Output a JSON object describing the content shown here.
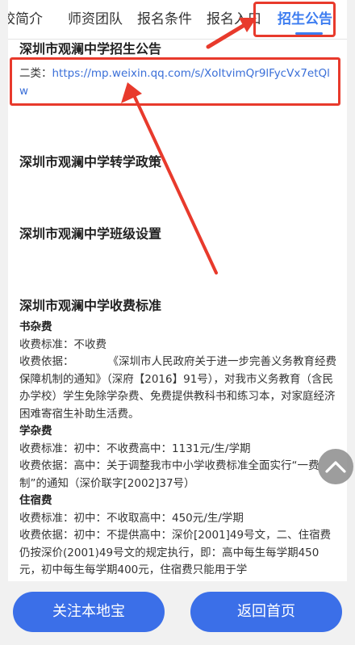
{
  "tabs": [
    {
      "label": "校简介"
    },
    {
      "label": "师资团队"
    },
    {
      "label": "报名条件"
    },
    {
      "label": "报名入口"
    },
    {
      "label": "招生公告"
    }
  ],
  "active_tab": "招生公告",
  "sections": {
    "admission_notice": {
      "title": "深圳市观澜中学招生公告",
      "link_prefix": "二类：",
      "link_url": "https://mp.weixin.qq.com/s/XoItvimQr9lFycVx7etQlw"
    },
    "transfer_policy": {
      "title": "深圳市观澜中学转学政策"
    },
    "class_settings": {
      "title": "深圳市观澜中学班级设置"
    },
    "fee_standard": {
      "title": "深圳市观澜中学收费标准",
      "book_fee": {
        "title": "书杂费",
        "standard": "收费标准：不收费",
        "basis_label": "收费依据：",
        "basis": "《深圳市人民政府关于进一步完善义务教育经费保障机制的通知》（深府【2016】91号），对我市义务教育（含民办学校）学生免除学杂费、免费提供教科书和练习本，对家庭经济困难寄宿生补助生活费。"
      },
      "tuition_fee": {
        "title": "学杂费",
        "standard": "收费标准：初中：不收费高中：1131元/生/学期",
        "basis": "收费依据：高中：关于调整我市中小学收费标准全面实行“一费制”的通知（深价联字[2002]37号）"
      },
      "boarding_fee": {
        "title": "住宿费",
        "standard": "收费标准：初中：不收取高中：450元/生/学期",
        "basis": "收费依据：初中：不提供高中：深价[2001]49号文，二、住宿费仍按深价(2001)49号文的规定执行，即：高中每生每学期450元，初中每生每学期400元，住宿费只能用于学"
      }
    }
  },
  "buttons": {
    "follow": "关注本地宝",
    "home": "返回首页"
  },
  "icons": {
    "scroll_top": "chevron-up-icon"
  },
  "colors": {
    "accent": "#3c7cf0",
    "button": "#3b6fe8",
    "annotation": "#e83a2c"
  }
}
